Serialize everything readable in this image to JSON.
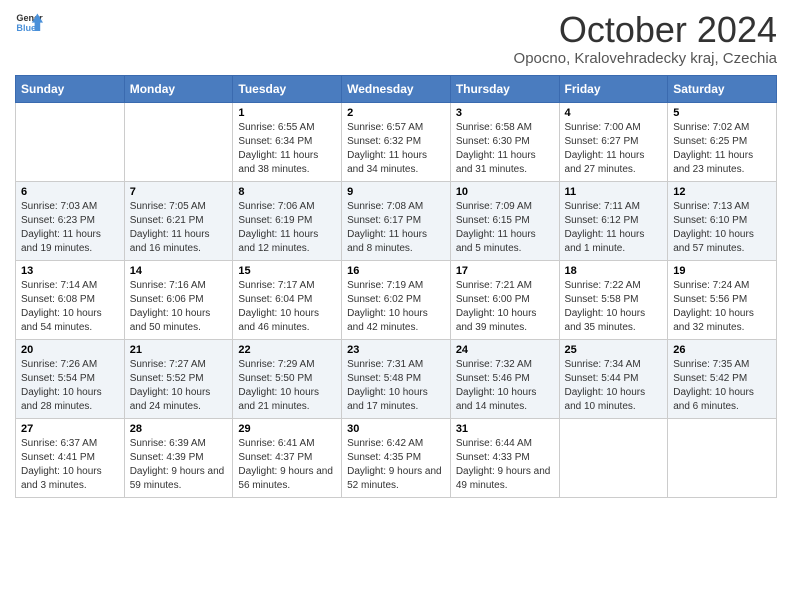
{
  "header": {
    "logo_general": "General",
    "logo_blue": "Blue",
    "title": "October 2024",
    "subtitle": "Opocno, Kralovehradecky kraj, Czechia"
  },
  "weekdays": [
    "Sunday",
    "Monday",
    "Tuesday",
    "Wednesday",
    "Thursday",
    "Friday",
    "Saturday"
  ],
  "weeks": [
    [
      {
        "day": "",
        "info": ""
      },
      {
        "day": "",
        "info": ""
      },
      {
        "day": "1",
        "info": "Sunrise: 6:55 AM\nSunset: 6:34 PM\nDaylight: 11 hours and 38 minutes."
      },
      {
        "day": "2",
        "info": "Sunrise: 6:57 AM\nSunset: 6:32 PM\nDaylight: 11 hours and 34 minutes."
      },
      {
        "day": "3",
        "info": "Sunrise: 6:58 AM\nSunset: 6:30 PM\nDaylight: 11 hours and 31 minutes."
      },
      {
        "day": "4",
        "info": "Sunrise: 7:00 AM\nSunset: 6:27 PM\nDaylight: 11 hours and 27 minutes."
      },
      {
        "day": "5",
        "info": "Sunrise: 7:02 AM\nSunset: 6:25 PM\nDaylight: 11 hours and 23 minutes."
      }
    ],
    [
      {
        "day": "6",
        "info": "Sunrise: 7:03 AM\nSunset: 6:23 PM\nDaylight: 11 hours and 19 minutes."
      },
      {
        "day": "7",
        "info": "Sunrise: 7:05 AM\nSunset: 6:21 PM\nDaylight: 11 hours and 16 minutes."
      },
      {
        "day": "8",
        "info": "Sunrise: 7:06 AM\nSunset: 6:19 PM\nDaylight: 11 hours and 12 minutes."
      },
      {
        "day": "9",
        "info": "Sunrise: 7:08 AM\nSunset: 6:17 PM\nDaylight: 11 hours and 8 minutes."
      },
      {
        "day": "10",
        "info": "Sunrise: 7:09 AM\nSunset: 6:15 PM\nDaylight: 11 hours and 5 minutes."
      },
      {
        "day": "11",
        "info": "Sunrise: 7:11 AM\nSunset: 6:12 PM\nDaylight: 11 hours and 1 minute."
      },
      {
        "day": "12",
        "info": "Sunrise: 7:13 AM\nSunset: 6:10 PM\nDaylight: 10 hours and 57 minutes."
      }
    ],
    [
      {
        "day": "13",
        "info": "Sunrise: 7:14 AM\nSunset: 6:08 PM\nDaylight: 10 hours and 54 minutes."
      },
      {
        "day": "14",
        "info": "Sunrise: 7:16 AM\nSunset: 6:06 PM\nDaylight: 10 hours and 50 minutes."
      },
      {
        "day": "15",
        "info": "Sunrise: 7:17 AM\nSunset: 6:04 PM\nDaylight: 10 hours and 46 minutes."
      },
      {
        "day": "16",
        "info": "Sunrise: 7:19 AM\nSunset: 6:02 PM\nDaylight: 10 hours and 42 minutes."
      },
      {
        "day": "17",
        "info": "Sunrise: 7:21 AM\nSunset: 6:00 PM\nDaylight: 10 hours and 39 minutes."
      },
      {
        "day": "18",
        "info": "Sunrise: 7:22 AM\nSunset: 5:58 PM\nDaylight: 10 hours and 35 minutes."
      },
      {
        "day": "19",
        "info": "Sunrise: 7:24 AM\nSunset: 5:56 PM\nDaylight: 10 hours and 32 minutes."
      }
    ],
    [
      {
        "day": "20",
        "info": "Sunrise: 7:26 AM\nSunset: 5:54 PM\nDaylight: 10 hours and 28 minutes."
      },
      {
        "day": "21",
        "info": "Sunrise: 7:27 AM\nSunset: 5:52 PM\nDaylight: 10 hours and 24 minutes."
      },
      {
        "day": "22",
        "info": "Sunrise: 7:29 AM\nSunset: 5:50 PM\nDaylight: 10 hours and 21 minutes."
      },
      {
        "day": "23",
        "info": "Sunrise: 7:31 AM\nSunset: 5:48 PM\nDaylight: 10 hours and 17 minutes."
      },
      {
        "day": "24",
        "info": "Sunrise: 7:32 AM\nSunset: 5:46 PM\nDaylight: 10 hours and 14 minutes."
      },
      {
        "day": "25",
        "info": "Sunrise: 7:34 AM\nSunset: 5:44 PM\nDaylight: 10 hours and 10 minutes."
      },
      {
        "day": "26",
        "info": "Sunrise: 7:35 AM\nSunset: 5:42 PM\nDaylight: 10 hours and 6 minutes."
      }
    ],
    [
      {
        "day": "27",
        "info": "Sunrise: 6:37 AM\nSunset: 4:41 PM\nDaylight: 10 hours and 3 minutes."
      },
      {
        "day": "28",
        "info": "Sunrise: 6:39 AM\nSunset: 4:39 PM\nDaylight: 9 hours and 59 minutes."
      },
      {
        "day": "29",
        "info": "Sunrise: 6:41 AM\nSunset: 4:37 PM\nDaylight: 9 hours and 56 minutes."
      },
      {
        "day": "30",
        "info": "Sunrise: 6:42 AM\nSunset: 4:35 PM\nDaylight: 9 hours and 52 minutes."
      },
      {
        "day": "31",
        "info": "Sunrise: 6:44 AM\nSunset: 4:33 PM\nDaylight: 9 hours and 49 minutes."
      },
      {
        "day": "",
        "info": ""
      },
      {
        "day": "",
        "info": ""
      }
    ]
  ]
}
